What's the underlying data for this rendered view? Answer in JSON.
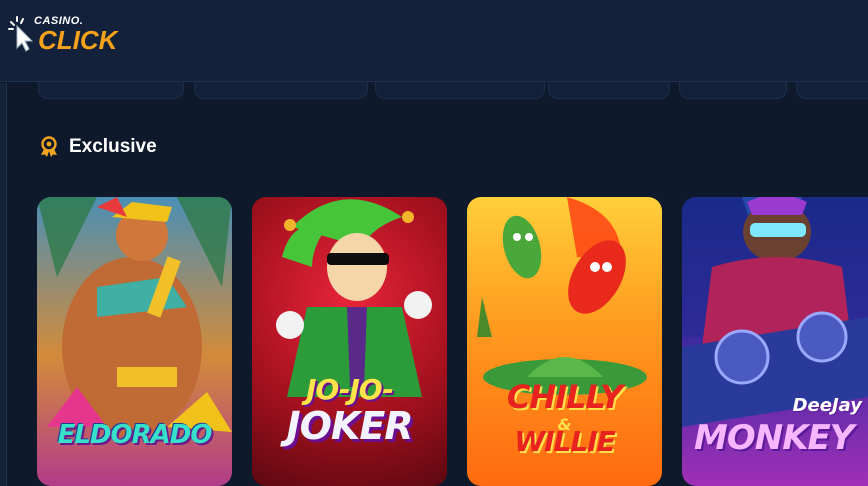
{
  "brand": {
    "small": "CASINO.",
    "big": "CLICK",
    "accent": "#f7a21b"
  },
  "section": {
    "title": "Exclusive",
    "icon": "medal-icon"
  },
  "games": [
    {
      "title": "ELDORADO"
    },
    {
      "title_top": "JO-JO-",
      "title_bottom": "JOKER"
    },
    {
      "title_top": "CHILLY",
      "title_amp": "&",
      "title_bottom": "WILLIE"
    },
    {
      "title_top": "DeeJay",
      "title_bottom": "MONKEY"
    }
  ],
  "colors": {
    "background": "#0e1a2b",
    "header": "#13223a",
    "section_icon": "#f2a51f"
  }
}
